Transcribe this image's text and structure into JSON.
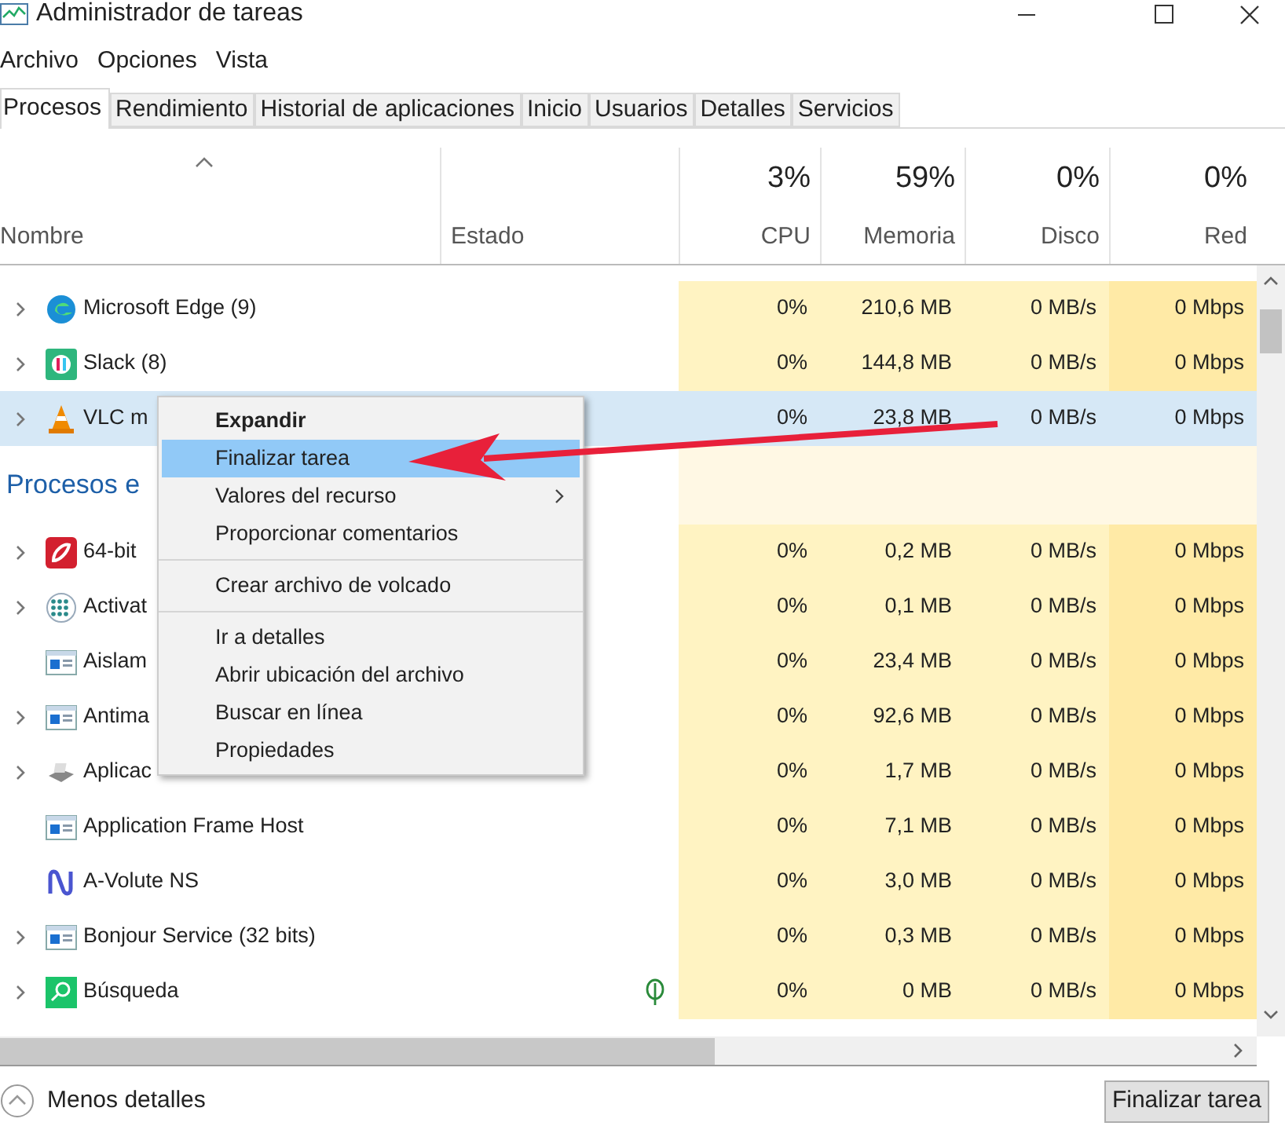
{
  "window": {
    "title": "Administrador de tareas"
  },
  "menu": [
    "Archivo",
    "Opciones",
    "Vista"
  ],
  "tabs": [
    {
      "label": "Procesos",
      "selected": true
    },
    {
      "label": "Rendimiento",
      "selected": false
    },
    {
      "label": "Historial de aplicaciones",
      "selected": false
    },
    {
      "label": "Inicio",
      "selected": false
    },
    {
      "label": "Usuarios",
      "selected": false
    },
    {
      "label": "Detalles",
      "selected": false
    },
    {
      "label": "Servicios",
      "selected": false
    }
  ],
  "columns": [
    {
      "label": "Nombre"
    },
    {
      "label": "Estado"
    },
    {
      "label": "CPU",
      "total": "3%"
    },
    {
      "label": "Memoria",
      "total": "59%"
    },
    {
      "label": "Disco",
      "total": "0%"
    },
    {
      "label": "Red",
      "total": "0%"
    }
  ],
  "rows": [
    {
      "kind": "process",
      "name": "Microsoft Edge (9)",
      "expandable": true,
      "selected": false,
      "eco": false,
      "cpu": "0%",
      "memory": "210,6 MB",
      "disk": "0 MB/s",
      "network": "0 Mbps"
    },
    {
      "kind": "process",
      "name": "Slack (8)",
      "expandable": true,
      "selected": false,
      "eco": false,
      "cpu": "0%",
      "memory": "144,8 MB",
      "disk": "0 MB/s",
      "network": "0 Mbps"
    },
    {
      "kind": "process",
      "name": "VLC m",
      "expandable": true,
      "selected": true,
      "eco": false,
      "cpu": "0%",
      "memory": "23,8 MB",
      "disk": "0 MB/s",
      "network": "0 Mbps"
    },
    {
      "kind": "section",
      "name": "Procesos e"
    },
    {
      "kind": "process",
      "name": "64-bit",
      "expandable": true,
      "selected": false,
      "eco": false,
      "cpu": "0%",
      "memory": "0,2 MB",
      "disk": "0 MB/s",
      "network": "0 Mbps"
    },
    {
      "kind": "process",
      "name": "Activat",
      "expandable": true,
      "selected": false,
      "eco": false,
      "cpu": "0%",
      "memory": "0,1 MB",
      "disk": "0 MB/s",
      "network": "0 Mbps"
    },
    {
      "kind": "process",
      "name": "Aislam",
      "expandable": false,
      "selected": false,
      "eco": false,
      "cpu": "0%",
      "memory": "23,4 MB",
      "disk": "0 MB/s",
      "network": "0 Mbps"
    },
    {
      "kind": "process",
      "name": "Antima",
      "expandable": true,
      "selected": false,
      "eco": false,
      "cpu": "0%",
      "memory": "92,6 MB",
      "disk": "0 MB/s",
      "network": "0 Mbps"
    },
    {
      "kind": "process",
      "name": "Aplicac",
      "expandable": true,
      "selected": false,
      "eco": false,
      "cpu": "0%",
      "memory": "1,7 MB",
      "disk": "0 MB/s",
      "network": "0 Mbps"
    },
    {
      "kind": "process",
      "name": "Application Frame Host",
      "expandable": false,
      "selected": false,
      "eco": false,
      "cpu": "0%",
      "memory": "7,1 MB",
      "disk": "0 MB/s",
      "network": "0 Mbps"
    },
    {
      "kind": "process",
      "name": "A-Volute NS",
      "expandable": false,
      "selected": false,
      "eco": false,
      "cpu": "0%",
      "memory": "3,0 MB",
      "disk": "0 MB/s",
      "network": "0 Mbps"
    },
    {
      "kind": "process",
      "name": "Bonjour Service (32 bits)",
      "expandable": true,
      "selected": false,
      "eco": false,
      "cpu": "0%",
      "memory": "0,3 MB",
      "disk": "0 MB/s",
      "network": "0 Mbps"
    },
    {
      "kind": "process",
      "name": "Búsqueda",
      "expandable": true,
      "selected": false,
      "eco": true,
      "cpu": "0%",
      "memory": "0 MB",
      "disk": "0 MB/s",
      "network": "0 Mbps"
    }
  ],
  "context_menu": [
    {
      "kind": "item",
      "label": "Expandir",
      "default": true,
      "selected": false,
      "submenu": false
    },
    {
      "kind": "item",
      "label": "Finalizar tarea",
      "default": false,
      "selected": true,
      "submenu": false
    },
    {
      "kind": "item",
      "label": "Valores del recurso",
      "default": false,
      "selected": false,
      "submenu": true
    },
    {
      "kind": "item",
      "label": "Proporcionar comentarios",
      "default": false,
      "selected": false,
      "submenu": false
    },
    {
      "kind": "separator"
    },
    {
      "kind": "item",
      "label": "Crear archivo de volcado",
      "default": false,
      "selected": false,
      "submenu": false
    },
    {
      "kind": "separator"
    },
    {
      "kind": "item",
      "label": "Ir a detalles",
      "default": false,
      "selected": false,
      "submenu": false
    },
    {
      "kind": "item",
      "label": "Abrir ubicación del archivo",
      "default": false,
      "selected": false,
      "submenu": false
    },
    {
      "kind": "item",
      "label": "Buscar en línea",
      "default": false,
      "selected": false,
      "submenu": false
    },
    {
      "kind": "item",
      "label": "Propiedades",
      "default": false,
      "selected": false,
      "submenu": false
    }
  ],
  "footer": {
    "toggle": "Menos detalles",
    "button": "Finalizar tarea"
  }
}
